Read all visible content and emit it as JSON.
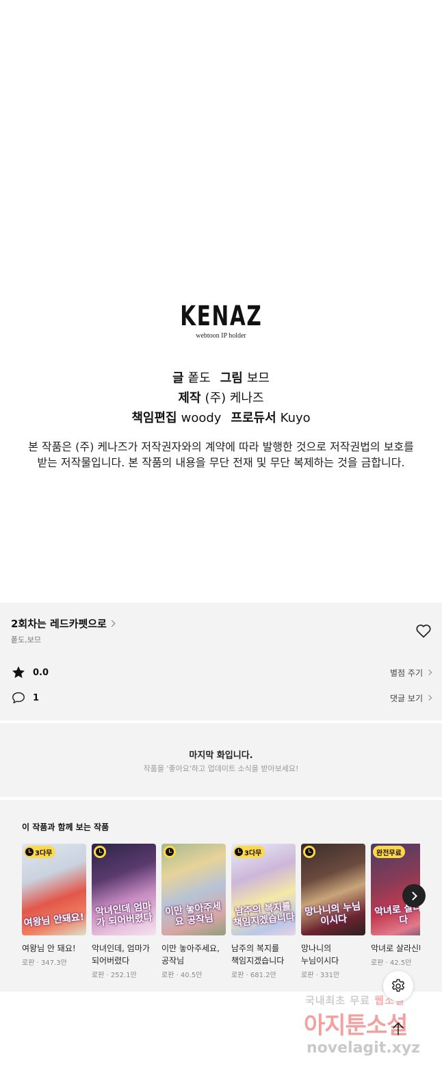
{
  "credits": {
    "logo": "KENAZ",
    "logo_sub": "webtoon IP holder",
    "writer_label": "글",
    "writer": "퐅도",
    "artist_label": "그림",
    "artist": "보므",
    "production_label": "제작",
    "production": "(주) 케나즈",
    "editor_label": "책임편집",
    "editor": "woody",
    "producer_label": "프로듀서",
    "producer": "Kuyo",
    "notice_line1": "본 작품은 (주) 케나즈가 저작권자와의 계약에 따라 발행한 것으로 저작권법의 보호를",
    "notice_line2": "받는 저작물입니다. 본 작품의 내용을 무단 전재 및 무단 복제하는 것을 금합니다."
  },
  "episode": {
    "title": "2회차는 레드카펫으로",
    "authors": "퐅도,보므",
    "rating": "0.0",
    "rate_label": "별점 주기",
    "comments": "1",
    "comments_label": "댓글 보기"
  },
  "last_episode": {
    "title": "마지막 화입니다.",
    "subtitle": "작품을 '좋아요'하고 업데이트 소식을 받아보세요!"
  },
  "recommendations": {
    "title": "이 작품과 함께 보는 작품",
    "items": [
      {
        "title": "여왕님 안 돼요!",
        "meta": "로판 · 347.3만",
        "badge": "3다무",
        "art": "여왕님 안돼요!",
        "bg": "linear-gradient(160deg,#dfe6ef 0%,#c9d2de 35%,#e2574a 60%,#f07d62 80%,#d9e3c8 100%)"
      },
      {
        "title": "악녀인데, 엄마가 되어버렸다",
        "meta": "로판 · 252.1만",
        "badge": "",
        "art": "악녀인데 엄마가 되어버렸다",
        "bg": "linear-gradient(160deg,#2c2547 0%,#5b3a6e 35%,#c58ac0 60%,#e9c6df 85%,#f3e3ee 100%)"
      },
      {
        "title": "이만 놓아주세요, 공작님",
        "meta": "로판 · 40.5만",
        "badge": "",
        "art": "이만 놓아주세요 공작님",
        "bg": "linear-gradient(160deg,#a7b98e 0%,#e7d39a 30%,#b6c3d6 55%,#d7a6a6 80%,#8f9f7a 100%)"
      },
      {
        "title": "남주의 복지를 책임지겠습니다",
        "meta": "로판 · 681.2만",
        "badge": "3다무",
        "art": "남주의 복지를 책임지겠습니다",
        "bg": "linear-gradient(160deg,#e8eef6 0%,#cdb6d9 35%,#f5e8a8 60%,#b9c7e6 85%,#e8d3e7 100%)"
      },
      {
        "title": "망나니의 누님이시다",
        "meta": "로판 · 331만",
        "badge": "",
        "art": "망나니의 누님이시다",
        "bg": "linear-gradient(160deg,#3a2d2c 0%,#6b4a3e 35%,#c9a57a 55%,#6b2430 80%,#2b2121 100%)"
      },
      {
        "title": "악녀로 살라신다",
        "meta": "로판 · 42.5만",
        "badge": "완전무료",
        "art": "악녀로 살라신다",
        "bg": "linear-gradient(160deg,#4a3d63 0%,#8a3b56 40%,#c23a50 65%,#e07a8a 85%,#5d4a7a 100%)"
      }
    ]
  },
  "watermark": {
    "line1_a": "국내최초 무료",
    "line1_b": "웹소설",
    "line2": "아지툰소설",
    "line3": "novelagit.xyz"
  }
}
